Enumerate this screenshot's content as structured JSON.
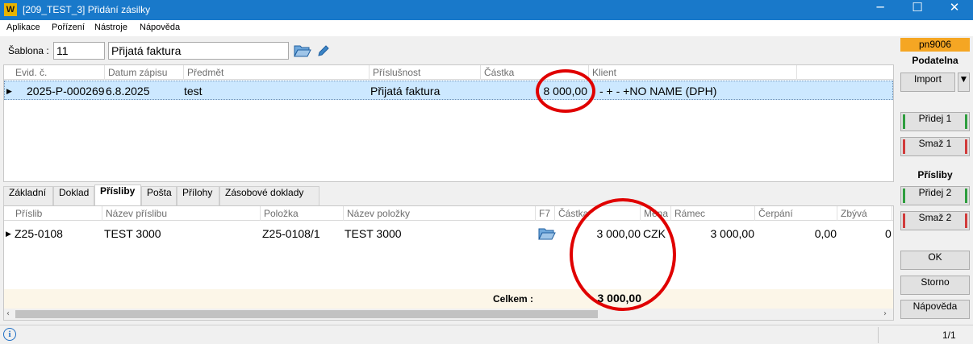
{
  "window": {
    "title": "[209_TEST_3] Přidání zásilky",
    "logo_letter": "W",
    "minimize": "─",
    "maximize": "☐",
    "close": "✕"
  },
  "menu": [
    "Aplikace",
    "Pořízení",
    "Nástroje",
    "Nápověda"
  ],
  "template": {
    "label": "Šablona :",
    "number": "11",
    "name": "Přijatá faktura"
  },
  "top_grid": {
    "columns": [
      "Evid. č.",
      "Datum zápisu",
      "Předmět",
      "Příslušnost",
      "Částka",
      "Klient"
    ],
    "rows": [
      {
        "evid": "2025-P-000269",
        "date": "6.8.2025",
        "subject": "test",
        "belonging": "Přijatá faktura",
        "amount": "8 000,00",
        "client": "- + - +NO NAME (DPH)"
      }
    ]
  },
  "tabs": [
    "Základní",
    "Doklad",
    "Přísliby",
    "Pošta",
    "Přílohy",
    "Zásobové doklady"
  ],
  "active_tab": "Přísliby",
  "bottom_grid": {
    "columns": [
      "Příslib",
      "Název příslibu",
      "Položka",
      "Název položky",
      "F7",
      "Částka",
      "Měna",
      "Rámec",
      "Čerpání",
      "Zbývá"
    ],
    "rows": [
      {
        "promise": "Z25-0108",
        "promise_name": "TEST 3000",
        "item": "Z25-0108/1",
        "item_name": "TEST 3000",
        "amount": "3 000,00",
        "currency": "CZK",
        "frame": "3 000,00",
        "drawn": "0,00",
        "remaining": "0"
      }
    ],
    "total_label": "Celkem :",
    "total_value": "3 000,00"
  },
  "right_panel": {
    "badge": "pn9006",
    "section1": "Podatelna",
    "import": "Import",
    "add1": "Přidej 1",
    "del1": "Smaž 1",
    "section2": "Přísliby",
    "add2": "Přidej 2",
    "del2": "Smaž 2",
    "ok": "OK",
    "cancel": "Storno",
    "help": "Nápověda"
  },
  "status": {
    "info_icon": "i",
    "page": "1/1"
  },
  "colors": {
    "titlebar": "#1979ca",
    "selected_row": "#cce8ff",
    "badge": "#f5a623",
    "annotation": "#e00000"
  }
}
